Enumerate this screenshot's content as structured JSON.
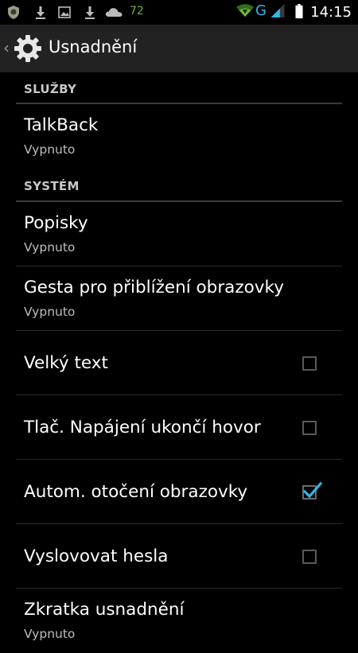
{
  "status_bar": {
    "battery_percent": "72",
    "network_type": "G",
    "time": "14:15"
  },
  "action_bar": {
    "title": "Usnadnění"
  },
  "sections": [
    {
      "header": "SLUŽBY",
      "items": [
        {
          "title": "TalkBack",
          "summary": "Vypnuto"
        }
      ]
    },
    {
      "header": "SYSTÉM",
      "items": [
        {
          "title": "Popisky",
          "summary": "Vypnuto"
        },
        {
          "title": "Gesta pro přiblížení obrazovky",
          "summary": "Vypnuto"
        },
        {
          "title": "Velký text",
          "checked": false
        },
        {
          "title": "Tlač. Napájení ukončí hovor",
          "checked": false
        },
        {
          "title": "Autom. otočení obrazovky",
          "checked": true
        },
        {
          "title": "Vyslovovat hesla",
          "checked": false
        },
        {
          "title": "Zkratka usnadnění",
          "summary": "Vypnuto"
        }
      ]
    }
  ],
  "colors": {
    "accent": "#33b5e5",
    "battery_green": "#6fb62f",
    "action_bar_bg": "#222222",
    "background": "#000000"
  }
}
